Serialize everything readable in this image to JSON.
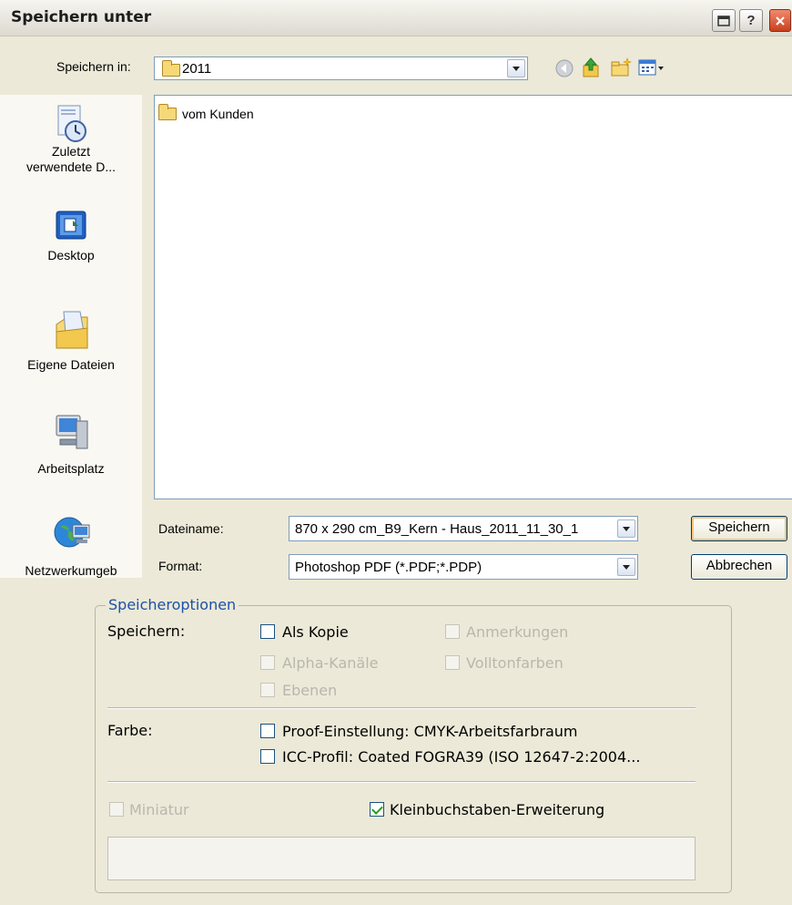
{
  "window": {
    "title": "Speichern unter",
    "help_glyph": "?"
  },
  "save_in": {
    "label": "Speichern in:",
    "value": "2011"
  },
  "places": [
    {
      "label": "Zuletzt verwendete D...",
      "icon": "recent-icon"
    },
    {
      "label": "Desktop",
      "icon": "desktop-icon"
    },
    {
      "label": "Eigene Dateien",
      "icon": "my-documents-icon"
    },
    {
      "label": "Arbeitsplatz",
      "icon": "my-computer-icon"
    },
    {
      "label": "Netzwerkumgeb",
      "icon": "network-icon"
    }
  ],
  "files": [
    {
      "name": "vom Kunden",
      "type": "folder"
    }
  ],
  "filename": {
    "label": "Dateiname:",
    "value": "870 x 290 cm_B9_Kern - Haus_2011_11_30_1"
  },
  "format": {
    "label": "Format:",
    "value": "Photoshop PDF (*.PDF;*.PDP)"
  },
  "buttons": {
    "save": "Speichern",
    "cancel": "Abbrechen"
  },
  "options": {
    "legend": "Speicheroptionen",
    "save_label": "Speichern:",
    "as_copy": {
      "label": "Als Kopie",
      "checked": false,
      "enabled": true
    },
    "annotations": {
      "label": "Anmerkungen",
      "checked": false,
      "enabled": false
    },
    "alpha_channels": {
      "label": "Alpha-Kanäle",
      "checked": false,
      "enabled": false
    },
    "spot_colors": {
      "label": "Volltonfarben",
      "checked": false,
      "enabled": false
    },
    "layers": {
      "label": "Ebenen",
      "checked": false,
      "enabled": false
    },
    "color_label": "Farbe:",
    "proof": {
      "label": "Proof-Einstellung: CMYK-Arbeitsfarbraum",
      "checked": false,
      "enabled": true
    },
    "icc": {
      "label": "ICC-Profil: Coated FOGRA39 (ISO 12647-2:2004...",
      "checked": false,
      "enabled": true
    },
    "thumbnail": {
      "label": "Miniatur",
      "checked": false,
      "enabled": false
    },
    "lowercase_ext": {
      "label": "Kleinbuchstaben-Erweiterung",
      "checked": true,
      "enabled": true
    }
  },
  "colors": {
    "legend_blue": "#1c52a9",
    "dialog_bg": "#ece9d8",
    "field_border": "#7f9db9"
  }
}
